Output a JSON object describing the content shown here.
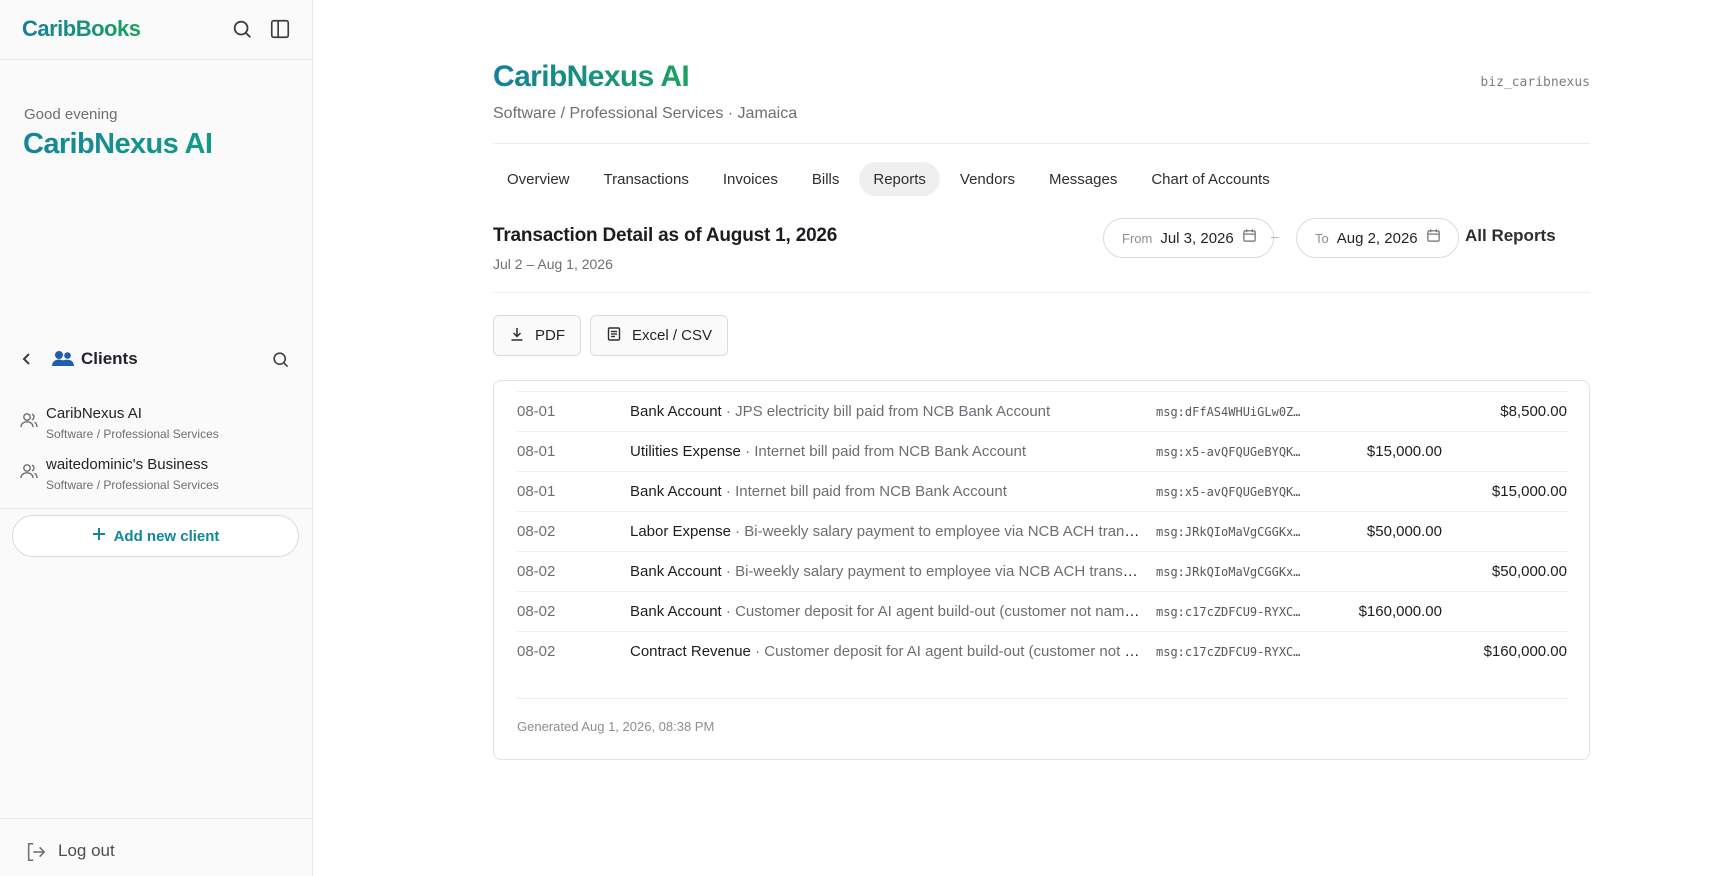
{
  "sidebar": {
    "brand": "CaribBooks",
    "greeting": "Good evening",
    "current_client": "CaribNexus AI",
    "clients_title": "Clients",
    "clients": [
      {
        "name": "CaribNexus AI",
        "category": "Software / Professional Services"
      },
      {
        "name": "waitedominic's Business",
        "category": "Software / Professional Services"
      }
    ],
    "add_client_label": "Add new client",
    "logout_label": "Log out"
  },
  "header": {
    "company_name": "CaribNexus AI",
    "company_subtitle": "Software / Professional Services · Jamaica",
    "business_id": "biz_caribnexus"
  },
  "tabs": [
    {
      "label": "Overview",
      "active": false
    },
    {
      "label": "Transactions",
      "active": false
    },
    {
      "label": "Invoices",
      "active": false
    },
    {
      "label": "Bills",
      "active": false
    },
    {
      "label": "Reports",
      "active": true
    },
    {
      "label": "Vendors",
      "active": false
    },
    {
      "label": "Messages",
      "active": false
    },
    {
      "label": "Chart of Accounts",
      "active": false
    }
  ],
  "report": {
    "title": "Transaction Detail as of August 1, 2026",
    "range": "Jul 2 – Aug 1, 2026",
    "from_label": "From",
    "from_value": "Jul 3, 2026",
    "to_label": "To",
    "to_value": "Aug 2, 2026",
    "separator": "–",
    "all_reports_label": "All Reports",
    "pdf_label": "PDF",
    "excel_label": "Excel / CSV",
    "generated": "Generated Aug 1, 2026, 08:38 PM"
  },
  "rows": [
    {
      "date": "08-01",
      "account": "Bank Account",
      "desc": "· JPS electricity bill paid from NCB Bank Account",
      "msg": "msg:dFfAS4WHUiGLw0Z…",
      "debit": "",
      "credit": "$8,500.00"
    },
    {
      "date": "08-01",
      "account": "Utilities Expense",
      "desc": "· Internet bill paid from NCB Bank Account",
      "msg": "msg:x5-avQFQUGeBYQK…",
      "debit": "$15,000.00",
      "credit": ""
    },
    {
      "date": "08-01",
      "account": "Bank Account",
      "desc": "· Internet bill paid from NCB Bank Account",
      "msg": "msg:x5-avQFQUGeBYQK…",
      "debit": "",
      "credit": "$15,000.00"
    },
    {
      "date": "08-02",
      "account": "Labor Expense",
      "desc": "· Bi-weekly salary payment to employee via NCB ACH transfe…",
      "msg": "msg:JRkQIoMaVgCGGKx…",
      "debit": "$50,000.00",
      "credit": ""
    },
    {
      "date": "08-02",
      "account": "Bank Account",
      "desc": "· Bi-weekly salary payment to employee via NCB ACH transfer…",
      "msg": "msg:JRkQIoMaVgCGGKx…",
      "debit": "",
      "credit": "$50,000.00"
    },
    {
      "date": "08-02",
      "account": "Bank Account",
      "desc": "· Customer deposit for AI agent build-out (customer not named)",
      "msg": "msg:c17cZDFCU9-RYXC…",
      "debit": "$160,000.00",
      "credit": ""
    },
    {
      "date": "08-02",
      "account": "Contract Revenue",
      "desc": "· Customer deposit for AI agent build-out (customer not na…",
      "msg": "msg:c17cZDFCU9-RYXC…",
      "debit": "",
      "credit": "$160,000.00"
    }
  ],
  "icons": [
    "search-icon",
    "sidebar-toggle-icon",
    "chevron-left-icon",
    "users-icon",
    "user-icon",
    "plus-icon",
    "logout-icon",
    "calendar-icon",
    "download-icon",
    "document-icon"
  ],
  "colors": {
    "accent_teal": "#13869a",
    "accent_green": "#1aa35c"
  }
}
